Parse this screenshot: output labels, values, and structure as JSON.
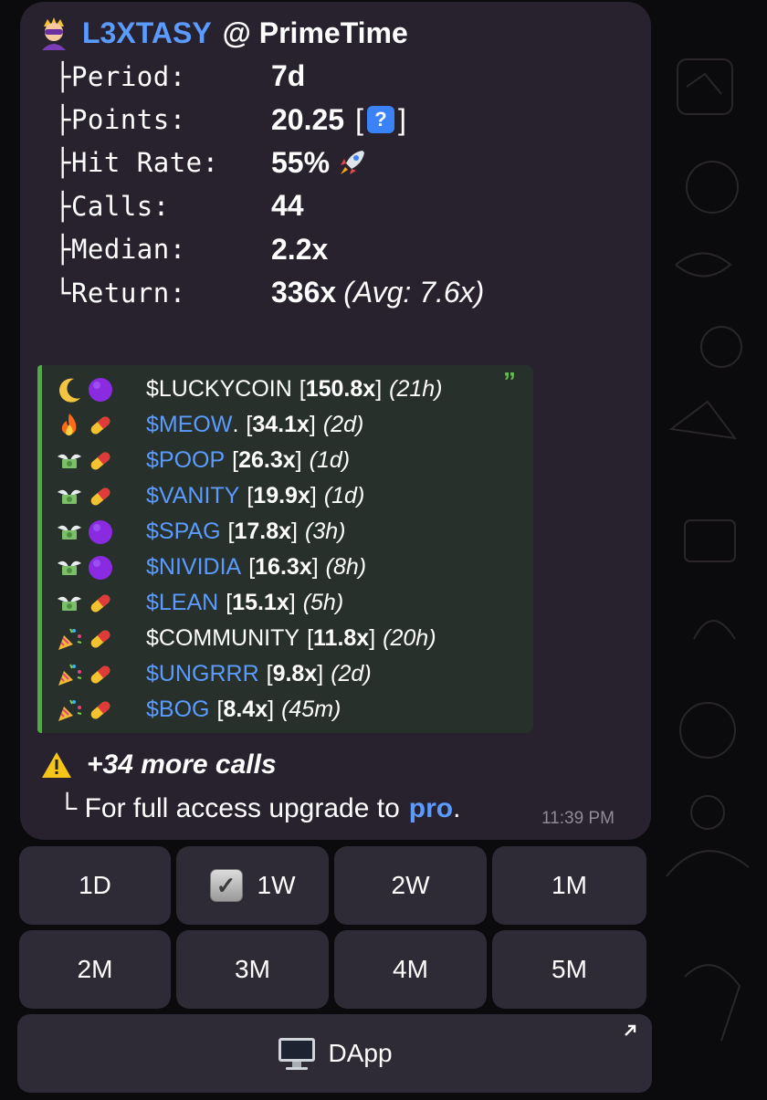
{
  "header": {
    "name": "L3XTASY",
    "at_label": "@ PrimeTime",
    "avatar_icon": "supervillain-emoji-icon"
  },
  "stats": [
    {
      "label": "├Period:",
      "value": "7d"
    },
    {
      "label": "├Points:",
      "value": "20.25",
      "suffix_open": "[",
      "suffix_close": "]",
      "icon": "info-icon"
    },
    {
      "label": "├Hit Rate:",
      "value": "55%",
      "icon": "rocket-icon"
    },
    {
      "label": "├Calls:",
      "value": "44"
    },
    {
      "label": "├Median:",
      "value": "2.2x"
    },
    {
      "label": "└Return:",
      "value": "336x",
      "extra": "(Avg: 7.6x)"
    }
  ],
  "calls": [
    {
      "icons": [
        "crescent-moon-icon",
        "purple-circle-icon"
      ],
      "ticker": "$LUCKYCOIN",
      "mult": "150.8x",
      "age": "(21h)",
      "link": false
    },
    {
      "icons": [
        "fire-icon",
        "pill-icon"
      ],
      "ticker": "$MEOW",
      "suffix": ".",
      "mult": "34.1x",
      "age": "(2d)",
      "link": true
    },
    {
      "icons": [
        "money-wings-icon",
        "pill-icon"
      ],
      "ticker": "$POOP",
      "mult": "26.3x",
      "age": "(1d)",
      "link": true
    },
    {
      "icons": [
        "money-wings-icon",
        "pill-icon"
      ],
      "ticker": "$VANITY",
      "mult": "19.9x",
      "age": "(1d)",
      "link": true
    },
    {
      "icons": [
        "money-wings-icon",
        "purple-circle-icon"
      ],
      "ticker": "$SPAG",
      "mult": "17.8x",
      "age": "(3h)",
      "link": true
    },
    {
      "icons": [
        "money-wings-icon",
        "purple-circle-icon"
      ],
      "ticker": "$NIVIDIA",
      "mult": "16.3x",
      "age": "(8h)",
      "link": true
    },
    {
      "icons": [
        "money-wings-icon",
        "pill-icon"
      ],
      "ticker": "$LEAN",
      "mult": "15.1x",
      "age": "(5h)",
      "link": true
    },
    {
      "icons": [
        "party-popper-icon",
        "pill-icon"
      ],
      "ticker": "$COMMUNITY",
      "mult": "11.8x",
      "age": "(20h)",
      "link": false
    },
    {
      "icons": [
        "party-popper-icon",
        "pill-icon"
      ],
      "ticker": "$UNGRRR",
      "mult": "9.8x",
      "age": "(2d)",
      "link": true
    },
    {
      "icons": [
        "party-popper-icon",
        "pill-icon"
      ],
      "ticker": "$BOG",
      "mult": "8.4x",
      "age": "(45m)",
      "link": true
    }
  ],
  "footer": {
    "more_calls": "+34 more calls",
    "upgrade_text": "└ For full access upgrade to",
    "upgrade_link": "pro",
    "upgrade_end": ".",
    "timestamp": "11:39 PM"
  },
  "keyboard": {
    "row1": [
      "1D",
      "1W",
      "2W",
      "1M"
    ],
    "row2": [
      "2M",
      "3M",
      "4M",
      "5M"
    ],
    "selected": "1W",
    "dapp_label": "DApp",
    "dapp_icon": "desktop-computer-icon"
  },
  "colors": {
    "link": "#5b9bff",
    "bubble": "#27222e",
    "quote_bar": "#4caf3c",
    "button": "#2e2a36"
  }
}
